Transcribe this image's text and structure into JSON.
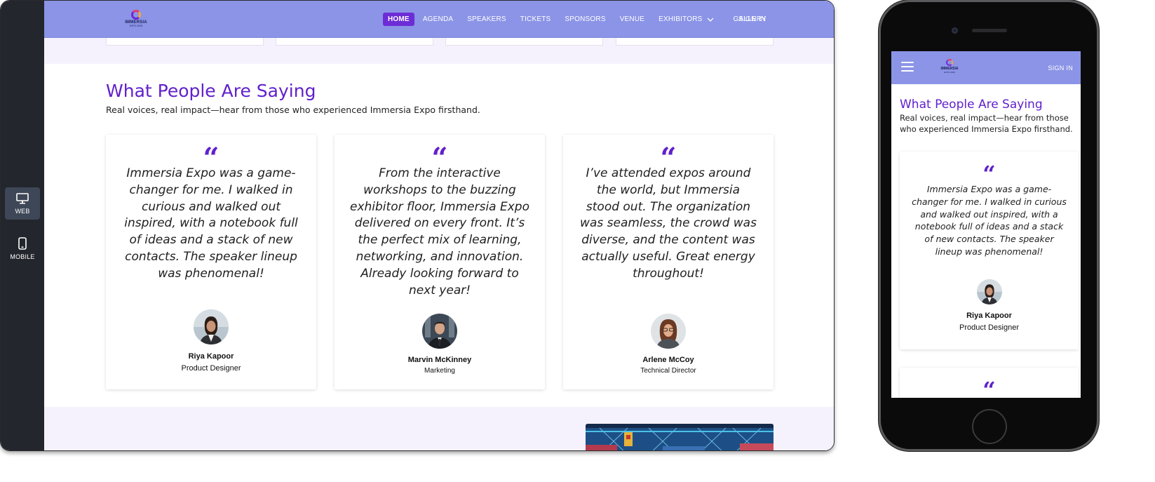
{
  "device_switcher": {
    "web_label": "WEB",
    "mobile_label": "MOBILE"
  },
  "site": {
    "logo_word": "IMMERSIA",
    "logo_sub": "EXPO 2025",
    "nav": [
      {
        "label": "HOME"
      },
      {
        "label": "AGENDA"
      },
      {
        "label": "SPEAKERS"
      },
      {
        "label": "TICKETS"
      },
      {
        "label": "SPONSORS"
      },
      {
        "label": "VENUE"
      },
      {
        "label": "EXHIBITORS"
      },
      {
        "label": "GALLERY"
      }
    ],
    "signin": "SIGN IN",
    "brand_color": "#6120cc",
    "nav_color": "#8b94e6"
  },
  "testimonials": {
    "title": "What People Are Saying",
    "subtitle": "Real voices, real impact—hear from those who experienced Immersia Expo firsthand.",
    "quote_glyph": "“",
    "items": [
      {
        "quote": "Immersia Expo was a game-changer for me. I walked in curious and walked out inspired, with a notebook full of ideas and a stack of new contacts. The speaker lineup was phenomenal!",
        "name": "Riya Kapoor",
        "role": "Product Designer"
      },
      {
        "quote": "From the interactive workshops to the buzzing exhibitor floor, Immersia Expo delivered on every front. It’s the perfect mix of learning, networking, and innovation. Already looking forward to next year!",
        "name": "Marvin McKinney",
        "role": "Marketing"
      },
      {
        "quote": "I’ve attended expos around the world, but Immersia stood out. The organization was seamless, the crowd was diverse, and the content was actually useful. Great energy throughout!",
        "name": "Arlene McCoy",
        "role": "Technical Director"
      }
    ]
  },
  "mobile": {
    "signin": "SIGN IN",
    "title": "What People Are Saying",
    "subtitle": "Real voices, real impact—hear from those who experienced Immersia Expo firsthand.",
    "quote": "Immersia Expo was a game-changer for me. I walked in curious and walked out inspired, with a notebook full of ideas and a stack of new contacts. The speaker lineup was phenomenal!",
    "name": "Riya Kapoor",
    "role": "Product Designer"
  }
}
